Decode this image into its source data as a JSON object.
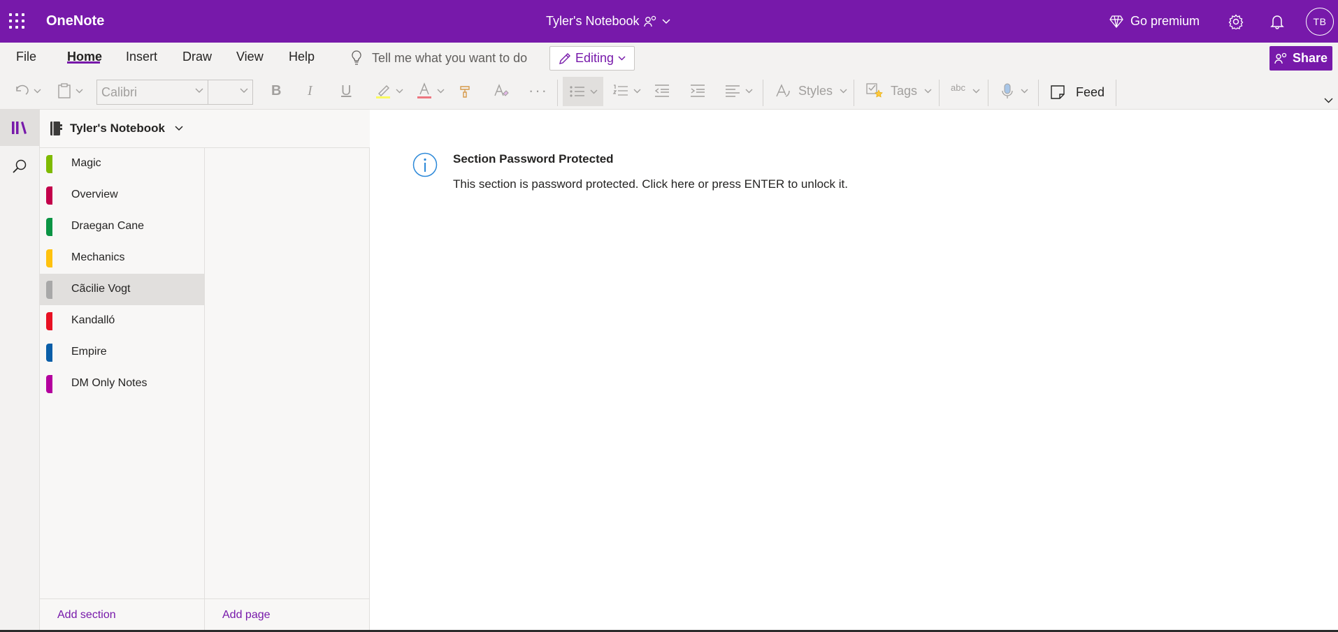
{
  "titlebar": {
    "app_name": "OneNote",
    "notebook_title": "Tyler's Notebook",
    "premium_label": "Go premium",
    "avatar_initials": "TB",
    "color": "#7719aa"
  },
  "ribbon": {
    "tabs": [
      {
        "label": "File"
      },
      {
        "label": "Home",
        "active": true
      },
      {
        "label": "Insert"
      },
      {
        "label": "Draw"
      },
      {
        "label": "View"
      },
      {
        "label": "Help"
      }
    ],
    "tell_me_placeholder": "Tell me what you want to do",
    "editing_label": "Editing",
    "share_label": "Share",
    "font_name": "Calibri",
    "font_size": "",
    "styles_label": "Styles",
    "tags_label": "Tags",
    "spell_label": "abc",
    "feed_label": "Feed"
  },
  "notebook": {
    "name": "Tyler's Notebook"
  },
  "sections": [
    {
      "label": "Magic",
      "color": "#7fba00"
    },
    {
      "label": "Overview",
      "color": "#c3004a"
    },
    {
      "label": "Draegan Cane",
      "color": "#0b9444"
    },
    {
      "label": "Mechanics",
      "color": "#ffc20e"
    },
    {
      "label": "Cãcilie Vogt",
      "color": "#a8a8a8",
      "selected": true
    },
    {
      "label": "Kandalló",
      "color": "#e81123"
    },
    {
      "label": "Empire",
      "color": "#0a5ea8"
    },
    {
      "label": "DM Only Notes",
      "color": "#b4009e"
    }
  ],
  "footer": {
    "add_section": "Add section",
    "add_page": "Add page"
  },
  "message": {
    "title": "Section Password Protected",
    "body": "This section is password protected. Click here or press ENTER to unlock it."
  }
}
